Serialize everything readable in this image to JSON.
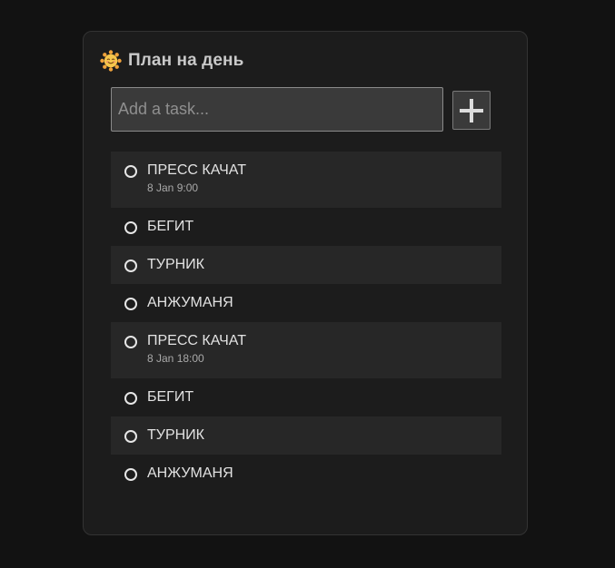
{
  "header": {
    "icon": "smiling-sun-icon",
    "title": "План на день"
  },
  "input": {
    "placeholder": "Add a task...",
    "value": ""
  },
  "add_button": {
    "icon": "plus-icon"
  },
  "colors": {
    "page_background": "#121212",
    "card_background": "#1c1c1c",
    "row_shaded": "#272727",
    "text": "#e2e2e2",
    "sun": "#f0a23b"
  },
  "tasks": [
    {
      "name": "ПРЕСС КАЧАТ",
      "date": "8 Jan 9:00"
    },
    {
      "name": "БЕГИТ",
      "date": ""
    },
    {
      "name": "ТУРНИК",
      "date": ""
    },
    {
      "name": "АНЖУМАНЯ",
      "date": ""
    },
    {
      "name": "ПРЕСС КАЧАТ",
      "date": "8 Jan 18:00"
    },
    {
      "name": "БЕГИТ",
      "date": ""
    },
    {
      "name": "ТУРНИК",
      "date": ""
    },
    {
      "name": "АНЖУМАНЯ",
      "date": ""
    }
  ]
}
